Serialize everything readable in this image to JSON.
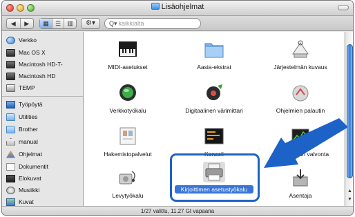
{
  "window": {
    "title": "Lisäohjelmat"
  },
  "search": {
    "placeholder": "kaikkialta"
  },
  "sidebar": {
    "devices": [
      {
        "label": "Verkko",
        "icon": "network-globe-icon"
      },
      {
        "label": "Mac OS X",
        "icon": "hard-disk-icon"
      },
      {
        "label": "Macintosh HD-T-",
        "icon": "hard-disk-icon"
      },
      {
        "label": "Macintosh HD",
        "icon": "hard-disk-icon"
      },
      {
        "label": "TEMP",
        "icon": "external-disk-icon"
      }
    ],
    "places": [
      {
        "label": "Työpöytä",
        "icon": "desktop-icon"
      },
      {
        "label": "Utilities",
        "icon": "folder-icon"
      },
      {
        "label": "Brother",
        "icon": "folder-icon"
      },
      {
        "label": "manual",
        "icon": "home-icon"
      },
      {
        "label": "Ohjelmat",
        "icon": "applications-icon"
      },
      {
        "label": "Dokumentit",
        "icon": "documents-icon"
      },
      {
        "label": "Elokuvat",
        "icon": "movies-icon"
      },
      {
        "label": "Musiikki",
        "icon": "music-icon"
      },
      {
        "label": "Kuvat",
        "icon": "pictures-icon"
      }
    ]
  },
  "items": [
    {
      "label": "MIDI-asetukset",
      "icon": "midi-keyboard-icon"
    },
    {
      "label": "Aasia-ekstrat",
      "icon": "folder-icon"
    },
    {
      "label": "Järjestelmän kuvaus",
      "icon": "system-profiler-icon"
    },
    {
      "label": "Verkkotyökalu",
      "icon": "network-utility-icon"
    },
    {
      "label": "Digitaalinen värimittari",
      "icon": "color-meter-icon"
    },
    {
      "label": "Ohjelmien palautin",
      "icon": "migration-icon"
    },
    {
      "label": "Hakemistopalvelut",
      "icon": "directory-services-icon"
    },
    {
      "label": "Konsoli",
      "icon": "console-icon"
    },
    {
      "label": "Järjestelmän valvonta",
      "icon": "activity-monitor-icon"
    },
    {
      "label": "Levytyökalu",
      "icon": "disk-utility-icon"
    },
    {
      "label": "Kirjoittimen asetustyökalu",
      "icon": "printer-setup-icon",
      "selected": true
    },
    {
      "label": "Asentaja",
      "icon": "installer-icon"
    }
  ],
  "status": {
    "text": "1/27 valittu, 11.27 Gt vapaana"
  },
  "colors": {
    "selection": "#3875d7",
    "callout": "#1d62c7"
  }
}
